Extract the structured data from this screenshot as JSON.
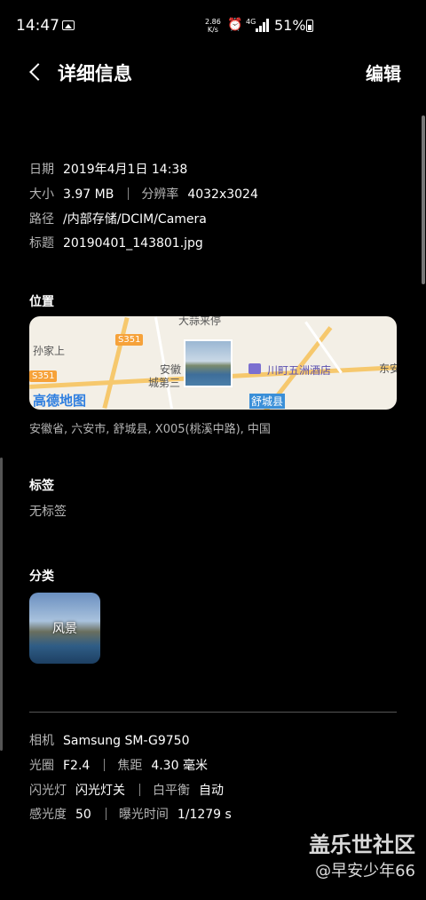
{
  "status_bar": {
    "time": "14:47",
    "speed_value": "2.86",
    "speed_unit": "K/s",
    "network": "4G",
    "battery": "51%"
  },
  "header": {
    "title": "详细信息",
    "edit_label": "编辑"
  },
  "details": {
    "date_label": "日期",
    "date_value": "2019年4月1日 14:38",
    "size_label": "大小",
    "size_value": "3.97 MB",
    "resolution_label": "分辨率",
    "resolution_value": "4032x3024",
    "path_label": "路径",
    "path_value": "/内部存储/DCIM/Camera",
    "name_label": "标题",
    "name_value": "20190401_143801.jpg"
  },
  "location": {
    "title": "位置",
    "address": "安徽省, 六安市, 舒城县, X005(桃溪中路), 中国",
    "map": {
      "labels": [
        "大蒜来停",
        "孙家上",
        "城第三",
        "安徽",
        "川町五洲酒店",
        "舒城县",
        "东安"
      ],
      "road_shields": [
        "S351",
        "S351"
      ],
      "logo": "高德地图"
    }
  },
  "tags": {
    "title": "标签",
    "empty_text": "无标签"
  },
  "category": {
    "title": "分类",
    "items": [
      {
        "label": "风景"
      }
    ]
  },
  "camera": {
    "model_label": "相机",
    "model_value": "Samsung SM-G9750",
    "aperture_label": "光圈",
    "aperture_value": "F2.4",
    "focal_label": "焦距",
    "focal_value": "4.30 毫米",
    "flash_label": "闪光灯",
    "flash_value": "闪光灯关",
    "wb_label": "白平衡",
    "wb_value": "自动",
    "iso_label": "感光度",
    "iso_value": "50",
    "exposure_label": "曝光时间",
    "exposure_value": "1/1279 s"
  },
  "watermark": {
    "line1": "盖乐世社区",
    "line2": "@早安少年66"
  }
}
